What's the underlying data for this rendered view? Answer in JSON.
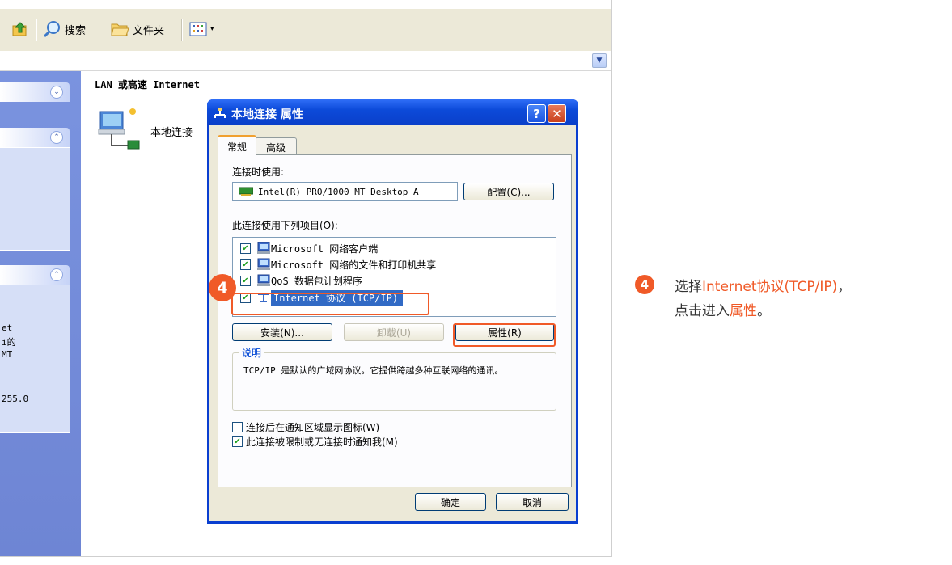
{
  "toolbar": {
    "search_label": "搜索",
    "folders_label": "文件夹"
  },
  "section_heading": "LAN 或高速 Internet",
  "connection_label": "本地连接",
  "left_partial_text": [
    "et",
    "i的",
    " MT",
    "255.0"
  ],
  "dialog": {
    "title": "本地连接 属性",
    "help_btn": "?",
    "close_btn": "✕",
    "tabs": [
      "常规",
      "高级"
    ],
    "connect_using_label": "连接时使用:",
    "adapter_name": "Intel(R) PRO/1000 MT Desktop A",
    "configure_button": "配置(C)...",
    "items_label": "此连接使用下列项目(O):",
    "items": [
      {
        "label": "Microsoft 网络客户端",
        "checked": true
      },
      {
        "label": "Microsoft 网络的文件和打印机共享",
        "checked": true
      },
      {
        "label": "QoS 数据包计划程序",
        "checked": true
      },
      {
        "label": "Internet 协议 (TCP/IP)",
        "checked": true,
        "selected": true
      }
    ],
    "install_button": "安装(N)...",
    "uninstall_button": "卸载(U)",
    "properties_button": "属性(R)",
    "description_title": "说明",
    "description_text": "TCP/IP 是默认的广域网协议。它提供跨越多种互联网络的通讯。",
    "show_icon_label": "连接后在通知区域显示图标(W)",
    "show_icon_checked": false,
    "notify_label": "此连接被限制或无连接时通知我(M)",
    "notify_checked": true,
    "ok_button": "确定",
    "cancel_button": "取消"
  },
  "step_badge": "4",
  "instruction": {
    "prefix": "选择",
    "highlight1": "Internet协议(TCP/IP)",
    "middle": "，",
    "line2_prefix": "点击进入",
    "highlight2": "属性",
    "suffix": "。"
  },
  "colors": {
    "accent": "#f05a28",
    "xp_blue": "#0a3fd0",
    "left_pane": "#7a93df"
  }
}
